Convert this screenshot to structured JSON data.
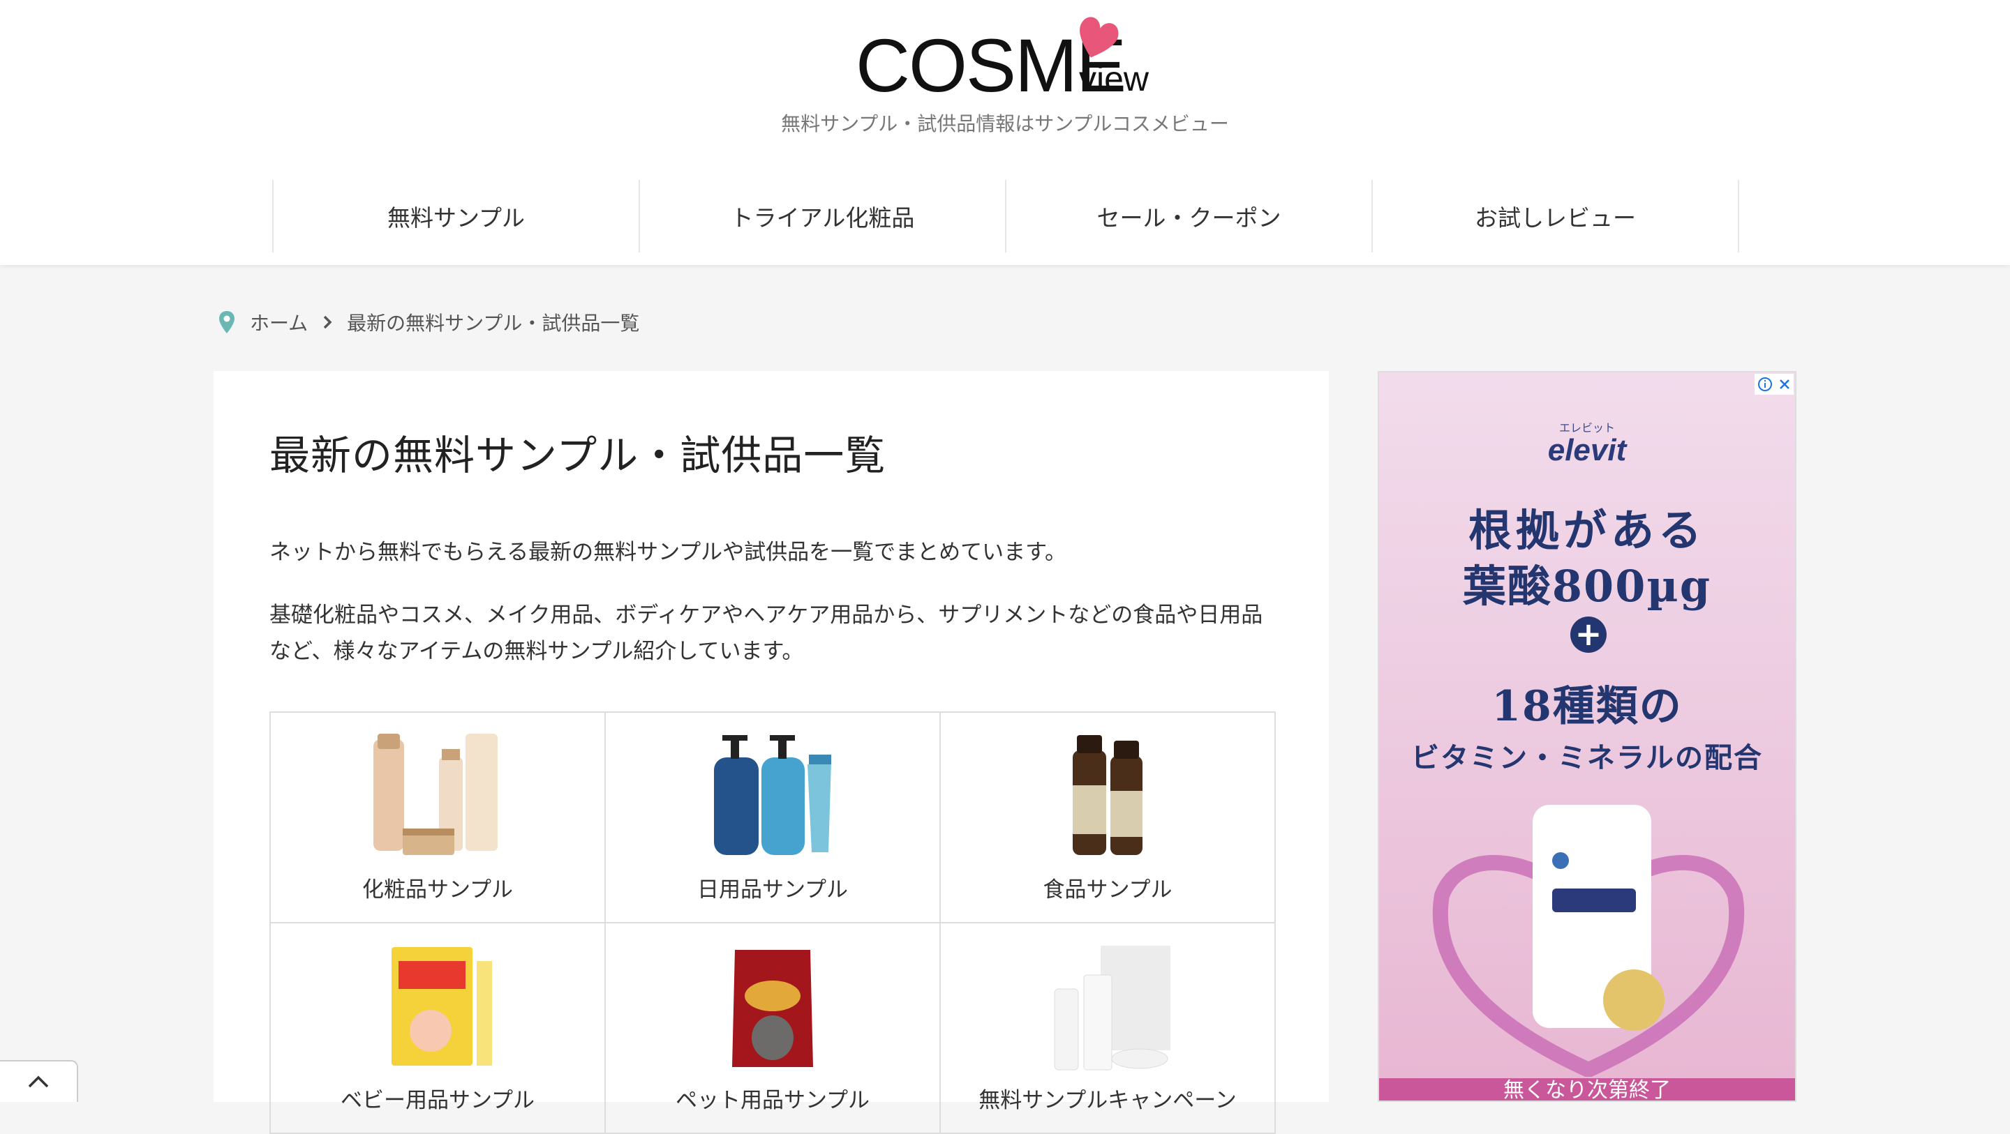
{
  "header": {
    "logo_main": "COSME",
    "logo_sub": "view",
    "tagline": "無料サンプル・試供品情報はサンプルコスメビュー"
  },
  "nav": {
    "items": [
      "無料サンプル",
      "トライアル化粧品",
      "セール・クーポン",
      "お試しレビュー"
    ]
  },
  "breadcrumb": {
    "home": "ホーム",
    "current": "最新の無料サンプル・試供品一覧"
  },
  "main": {
    "title": "最新の無料サンプル・試供品一覧",
    "intro1": "ネットから無料でもらえる最新の無料サンプルや試供品を一覧でまとめています。",
    "intro2": "基礎化粧品やコスメ、メイク用品、ボディケアやヘアケア用品から、サプリメントなどの食品や日用品など、様々なアイテムの無料サンプル紹介しています。",
    "categories": [
      {
        "label": "化粧品サンプル",
        "icon": "cosmetics-image"
      },
      {
        "label": "日用品サンプル",
        "icon": "daily-goods-image"
      },
      {
        "label": "食品サンプル",
        "icon": "food-image"
      },
      {
        "label": "ベビー用品サンプル",
        "icon": "baby-goods-image"
      },
      {
        "label": "ペット用品サンプル",
        "icon": "pet-goods-image"
      },
      {
        "label": "無料サンプルキャンペーン",
        "icon": "campaign-image"
      }
    ]
  },
  "ad": {
    "brand_small": "エレビット",
    "brand": "elevit",
    "line1": "根拠がある",
    "line2": "葉酸800µg",
    "plus": "+",
    "line3": "18種類の",
    "line4": "ビタミン・ミネラルの配合",
    "bottom": "無くなり次第終了"
  },
  "colors": {
    "accent_pink": "#e8577a",
    "pin_teal": "#6ab7b3",
    "ad_navy": "#23366f"
  }
}
